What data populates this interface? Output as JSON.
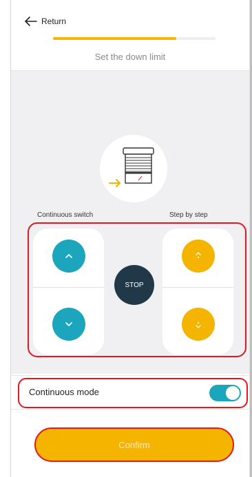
{
  "header": {
    "return_label": "Return",
    "step_title": "Set the down limit",
    "progress_fraction": 0.76
  },
  "device": {
    "icon": "roller-shutter-icon"
  },
  "controls": {
    "continuous_label": "Continuous switch",
    "step_label": "Step by step",
    "stop_label": "STOP",
    "icons": [
      "chevron-up-icon",
      "chevron-down-icon",
      "step-up-icon",
      "step-down-icon"
    ]
  },
  "mode": {
    "label": "Continuous mode",
    "enabled": true
  },
  "confirm": {
    "label": "Confirm"
  },
  "colors": {
    "accent_yellow": "#f5b400",
    "accent_teal": "#1ba6bd",
    "stop_dark": "#203848",
    "highlight_red": "#e5161e"
  }
}
